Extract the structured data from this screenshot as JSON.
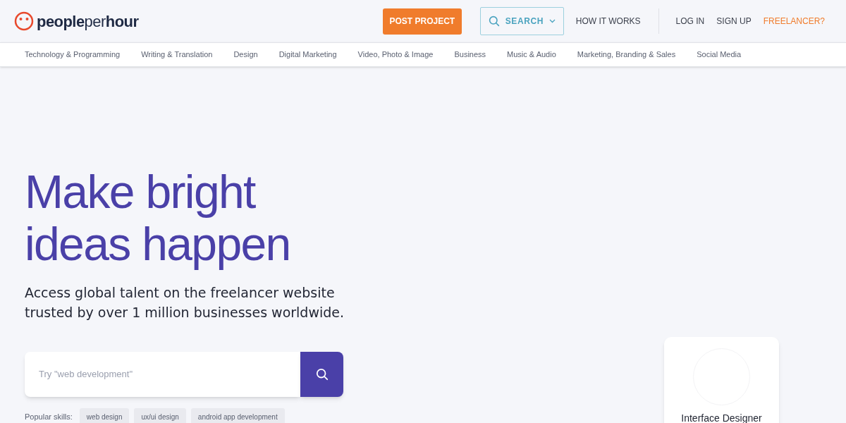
{
  "header": {
    "logo": "**people**per**hour**",
    "post_project": "POST PROJECT",
    "search": "SEARCH",
    "how_it_works": "HOW IT WORKS",
    "log_in": "LOG IN",
    "sign_up": "SIGN UP",
    "freelancer": "FREELANCER?"
  },
  "categories": [
    "Technology & Programming",
    "Writing & Translation",
    "Design",
    "Digital Marketing",
    "Video, Photo & Image",
    "Business",
    "Music & Audio",
    "Marketing, Branding & Sales",
    "Social Media"
  ],
  "hero": {
    "title_lines": [
      "Make bright",
      "ideas happen"
    ],
    "subtitle_lines": [
      "Access global talent on the freelancer website",
      "trusted by over 1 million businesses worldwide."
    ],
    "search_placeholder": "Try \"web development\"",
    "popular_label": "Popular skills:",
    "skills": [
      "web design",
      "ux/ui design",
      "android app development"
    ]
  },
  "card": {
    "title": "Interface Designer"
  }
}
